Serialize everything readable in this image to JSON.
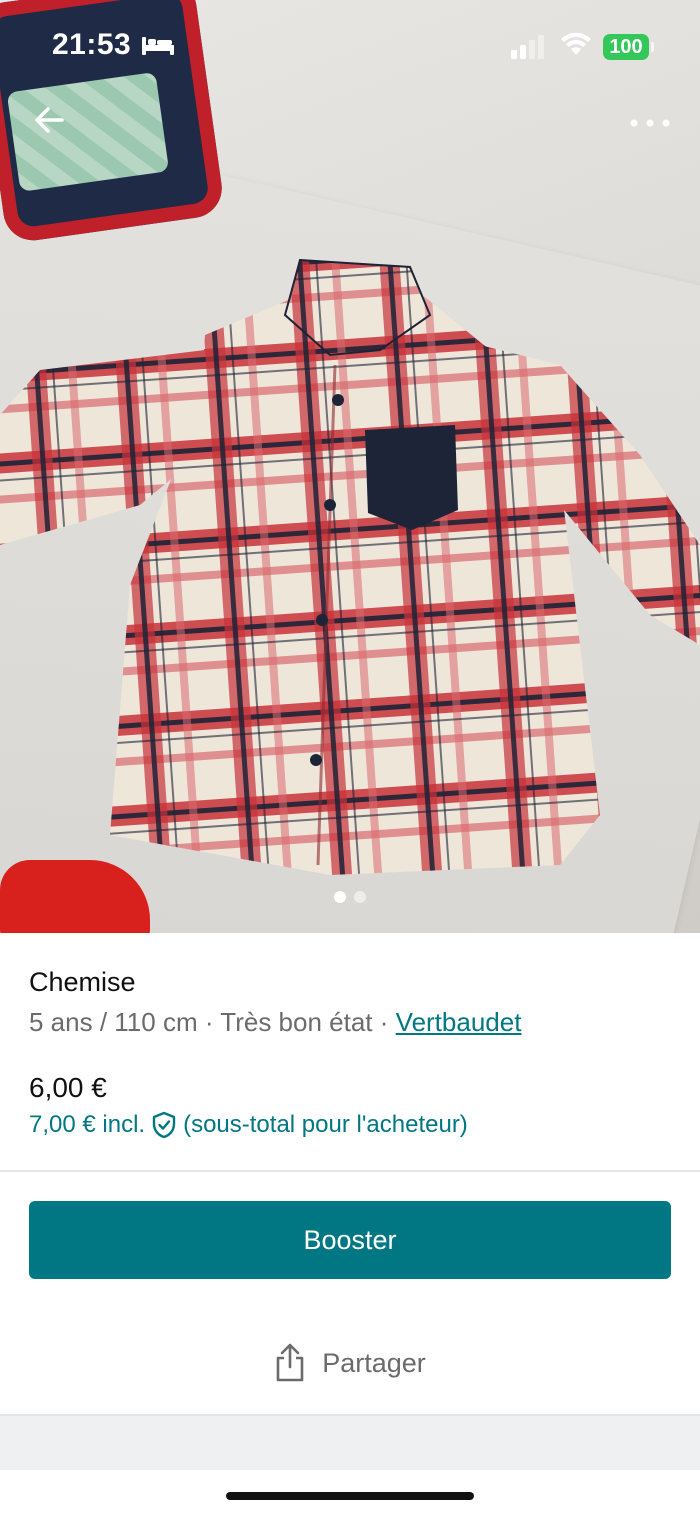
{
  "status_bar": {
    "time": "21:53",
    "battery": "100",
    "icons": [
      "bed-icon",
      "signal-icon",
      "wifi-icon",
      "battery-icon"
    ]
  },
  "top_bar": {
    "back_icon": "arrow-left-icon",
    "more_icon": "more-horizontal-icon"
  },
  "gallery": {
    "photo_count": 2,
    "active_index": 0
  },
  "item": {
    "title": "Chemise",
    "size": "5 ans / 110 cm",
    "separator": "·",
    "condition": "Très bon état",
    "brand": "Vertbaudet",
    "price": "6,00 €",
    "price_incl": "7,00 € incl.",
    "price_incl_note": "(sous-total pour l'acheteur)",
    "shield_icon": "shield-check-icon"
  },
  "actions": {
    "booster_label": "Booster",
    "share_label": "Partager",
    "share_icon": "share-icon"
  },
  "colors": {
    "accent": "#007782",
    "battery": "#34c759",
    "muted_text": "#6b6b6b"
  }
}
